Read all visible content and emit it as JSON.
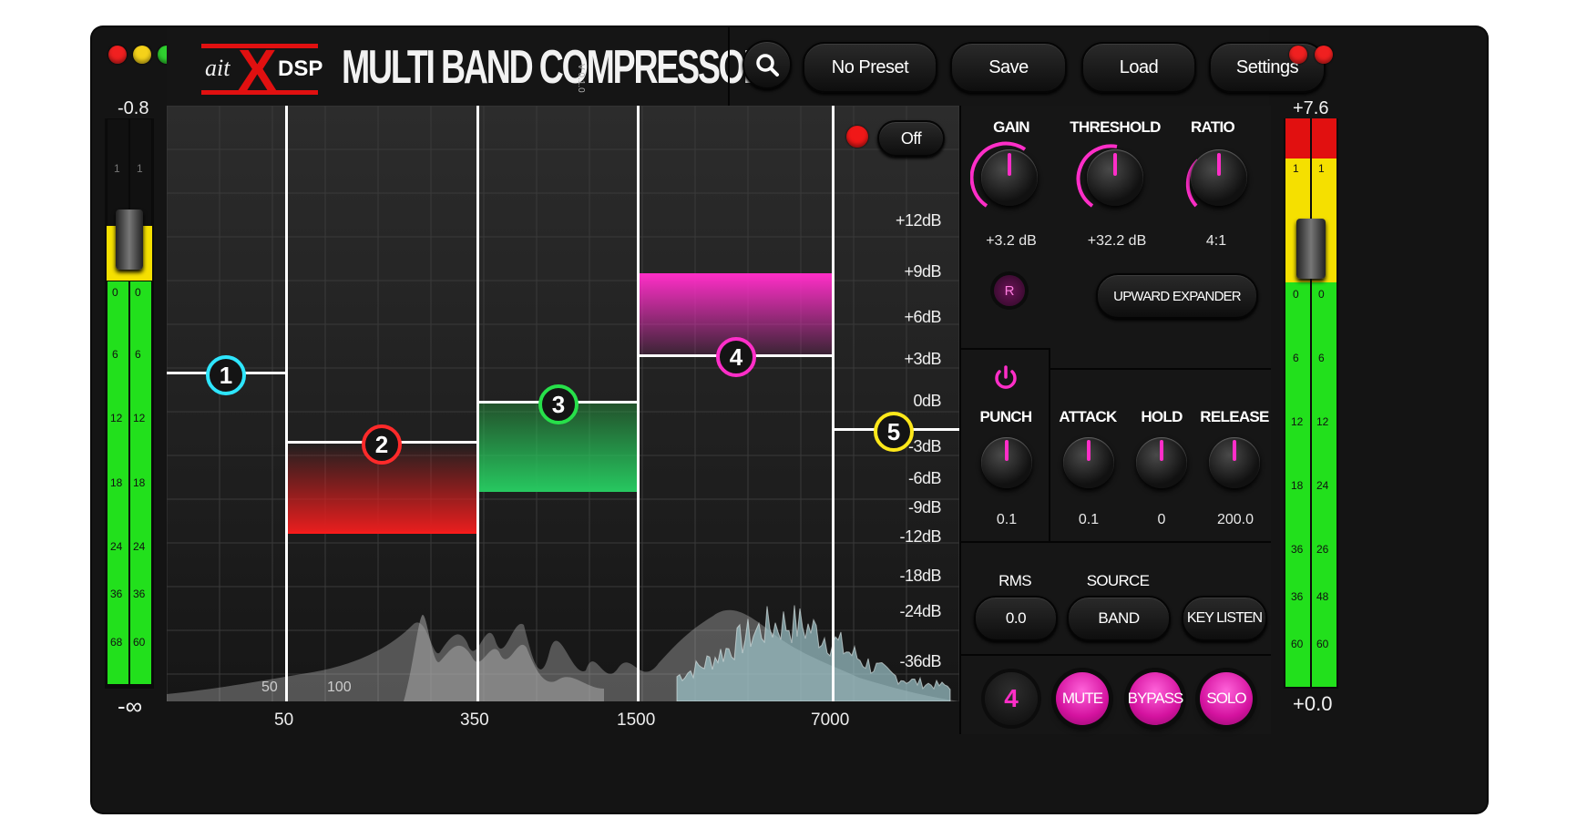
{
  "header": {
    "logo": {
      "prefix": "ait",
      "mark": "X",
      "suffix": "DSP"
    },
    "title": "MULTI BAND COMPRESSOR",
    "version": "V 0.1.0",
    "preset": "No Preset",
    "save": "Save",
    "load": "Load",
    "settings": "Settings"
  },
  "input_meter": {
    "peak": "-0.8",
    "gain": "-∞",
    "scale": [
      "1",
      "0",
      "6",
      "12",
      "18",
      "24",
      "36",
      "68"
    ],
    "scale_right": [
      "1",
      "0",
      "6",
      "12",
      "18",
      "24",
      "36",
      "60"
    ]
  },
  "output_meter": {
    "peak": "+7.6",
    "gain": "+0.0",
    "scale": [
      "1",
      "0",
      "6",
      "12",
      "18",
      "36",
      "36",
      "60"
    ],
    "scale_right": [
      "1",
      "0",
      "6",
      "12",
      "24",
      "26",
      "48",
      "60"
    ]
  },
  "graph": {
    "oversample_toggle": "Off",
    "db_labels": [
      "+12dB",
      "+9dB",
      "+6dB",
      "+3dB",
      "0dB",
      "-3dB",
      "-6dB",
      "-9dB",
      "-12dB",
      "-18dB",
      "-24dB",
      "-36dB"
    ],
    "freq_inner": [
      "50",
      "100"
    ],
    "crossovers": [
      "50",
      "350",
      "1500",
      "7000"
    ],
    "bands": [
      {
        "num": "1",
        "color": "#2ee6ff"
      },
      {
        "num": "2",
        "color": "#ff2a2a"
      },
      {
        "num": "3",
        "color": "#27e04a"
      },
      {
        "num": "4",
        "color": "#ff2ec8"
      },
      {
        "num": "5",
        "color": "#ffe81a"
      }
    ]
  },
  "controls": {
    "gain": {
      "label": "GAIN",
      "value": "+3.2 dB"
    },
    "threshold": {
      "label": "THRESHOLD",
      "value": "+32.2 dB"
    },
    "ratio": {
      "label": "RATIO",
      "value": "4:1"
    },
    "reset": "R",
    "mode": "UPWARD EXPANDER",
    "punch": {
      "label": "PUNCH",
      "value": "0.1"
    },
    "attack": {
      "label": "ATTACK",
      "value": "0.1"
    },
    "hold": {
      "label": "HOLD",
      "value": "0"
    },
    "release": {
      "label": "RELEASE",
      "value": "200.0"
    },
    "rms": {
      "label": "RMS",
      "value": "0.0"
    },
    "source": {
      "label": "SOURCE",
      "value": "BAND"
    },
    "key_listen": "KEY LISTEN",
    "selected_band": "4",
    "mute": "MUTE",
    "bypass": "BYPASS",
    "solo": "SOLO"
  },
  "colors": {
    "accent": "#ff2ec8",
    "meter_green": "#22e01c",
    "meter_yellow": "#f5e000",
    "meter_red": "#e11010"
  }
}
